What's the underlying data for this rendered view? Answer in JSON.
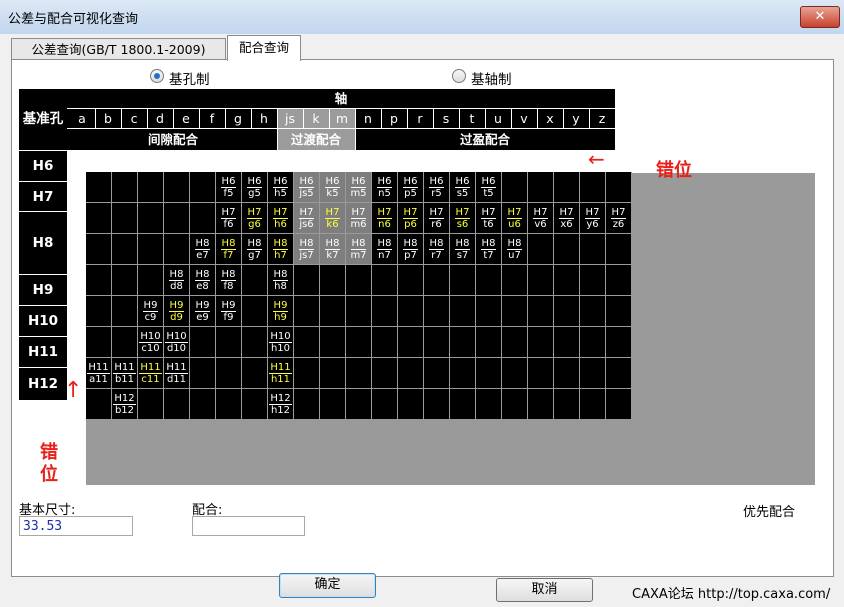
{
  "window": {
    "title": "公差与配合可视化查询",
    "close": "✕"
  },
  "tabs": [
    {
      "label": "公差查询(GB/T 1800.1-2009)"
    },
    {
      "label": "配合查询"
    }
  ],
  "radios": [
    {
      "label": "基孔制",
      "checked": true
    },
    {
      "label": "基轴制",
      "checked": false
    }
  ],
  "header": {
    "base_hole": "基准孔",
    "shaft": "轴",
    "letters": [
      "a",
      "b",
      "c",
      "d",
      "e",
      "f",
      "g",
      "h",
      "js",
      "k",
      "m",
      "n",
      "p",
      "r",
      "s",
      "t",
      "u",
      "v",
      "x",
      "y",
      "z"
    ],
    "groups": [
      "间隙配合",
      "过渡配合",
      "过盈配合"
    ]
  },
  "holes": [
    "H6",
    "H7",
    "H8",
    "H9",
    "H10",
    "H11",
    "H12"
  ],
  "fits": [
    [
      {
        "c": 5,
        "n": "H6",
        "d": "f5"
      },
      {
        "c": 6,
        "n": "H6",
        "d": "g5"
      },
      {
        "c": 7,
        "n": "H6",
        "d": "h5"
      },
      {
        "c": 8,
        "n": "H6",
        "d": "js5"
      },
      {
        "c": 9,
        "n": "H6",
        "d": "k5"
      },
      {
        "c": 10,
        "n": "H6",
        "d": "m5"
      },
      {
        "c": 11,
        "n": "H6",
        "d": "n5"
      },
      {
        "c": 12,
        "n": "H6",
        "d": "p5"
      },
      {
        "c": 13,
        "n": "H6",
        "d": "r5"
      },
      {
        "c": 14,
        "n": "H6",
        "d": "s5"
      },
      {
        "c": 15,
        "n": "H6",
        "d": "t5"
      }
    ],
    [
      {
        "c": 5,
        "n": "H7",
        "d": "f6"
      },
      {
        "c": 6,
        "n": "H7",
        "d": "g6",
        "p": true
      },
      {
        "c": 7,
        "n": "H7",
        "d": "h6",
        "p": true
      },
      {
        "c": 8,
        "n": "H7",
        "d": "js6"
      },
      {
        "c": 9,
        "n": "H7",
        "d": "k6",
        "p": true
      },
      {
        "c": 10,
        "n": "H7",
        "d": "m6"
      },
      {
        "c": 11,
        "n": "H7",
        "d": "n6",
        "p": true
      },
      {
        "c": 12,
        "n": "H7",
        "d": "p6",
        "p": true
      },
      {
        "c": 13,
        "n": "H7",
        "d": "r6"
      },
      {
        "c": 14,
        "n": "H7",
        "d": "s6",
        "p": true
      },
      {
        "c": 15,
        "n": "H7",
        "d": "t6"
      },
      {
        "c": 16,
        "n": "H7",
        "d": "u6",
        "p": true
      },
      {
        "c": 17,
        "n": "H7",
        "d": "v6"
      },
      {
        "c": 18,
        "n": "H7",
        "d": "x6"
      },
      {
        "c": 19,
        "n": "H7",
        "d": "y6"
      },
      {
        "c": 20,
        "n": "H7",
        "d": "z6"
      }
    ],
    [
      {
        "c": 4,
        "n": "H8",
        "d": "e7"
      },
      {
        "c": 5,
        "n": "H8",
        "d": "f7",
        "p": true
      },
      {
        "c": 6,
        "n": "H8",
        "d": "g7"
      },
      {
        "c": 7,
        "n": "H8",
        "d": "h7",
        "p": true
      },
      {
        "c": 8,
        "n": "H8",
        "d": "js7"
      },
      {
        "c": 9,
        "n": "H8",
        "d": "k7"
      },
      {
        "c": 10,
        "n": "H8",
        "d": "m7"
      },
      {
        "c": 11,
        "n": "H8",
        "d": "n7"
      },
      {
        "c": 12,
        "n": "H8",
        "d": "p7"
      },
      {
        "c": 13,
        "n": "H8",
        "d": "r7"
      },
      {
        "c": 14,
        "n": "H8",
        "d": "s7"
      },
      {
        "c": 15,
        "n": "H8",
        "d": "t7"
      },
      {
        "c": 16,
        "n": "H8",
        "d": "u7"
      }
    ],
    [
      {
        "c": 3,
        "n": "H8",
        "d": "d8"
      },
      {
        "c": 4,
        "n": "H8",
        "d": "e8"
      },
      {
        "c": 5,
        "n": "H8",
        "d": "f8"
      },
      {
        "c": 7,
        "n": "H8",
        "d": "h8"
      }
    ],
    [
      {
        "c": 2,
        "n": "H9",
        "d": "c9"
      },
      {
        "c": 3,
        "n": "H9",
        "d": "d9",
        "p": true
      },
      {
        "c": 4,
        "n": "H9",
        "d": "e9"
      },
      {
        "c": 5,
        "n": "H9",
        "d": "f9"
      },
      {
        "c": 7,
        "n": "H9",
        "d": "h9",
        "p": true
      }
    ],
    [
      {
        "c": 2,
        "n": "H10",
        "d": "c10"
      },
      {
        "c": 3,
        "n": "H10",
        "d": "d10"
      },
      {
        "c": 7,
        "n": "H10",
        "d": "h10"
      }
    ],
    [
      {
        "c": 0,
        "n": "H11",
        "d": "a11"
      },
      {
        "c": 1,
        "n": "H11",
        "d": "b11"
      },
      {
        "c": 2,
        "n": "H11",
        "d": "c11",
        "p": true
      },
      {
        "c": 3,
        "n": "H11",
        "d": "d11"
      },
      {
        "c": 7,
        "n": "H11",
        "d": "h11",
        "p": true
      }
    ],
    [
      {
        "c": 1,
        "n": "H12",
        "d": "b12"
      },
      {
        "c": 7,
        "n": "H12",
        "d": "h12"
      }
    ]
  ],
  "annotations": {
    "arrow_right": "←",
    "text_right": "错位",
    "arrow_up": "↑",
    "text_left_1": "错",
    "text_left_2": "位"
  },
  "form": {
    "basic_size_label": "基本尺寸:",
    "basic_size_value": "33.53",
    "fit_label": "配合:",
    "fit_value": "",
    "preferred_label": "优先配合"
  },
  "buttons": {
    "ok": "确定",
    "cancel": "取消"
  },
  "watermark": "CAXA论坛 http://top.caxa.com/",
  "colors": {
    "preferred_fit": "#ffff40",
    "grid_bg": "#000000",
    "transition_bg": "#7e7e7e",
    "annotation": "#e8201b"
  }
}
